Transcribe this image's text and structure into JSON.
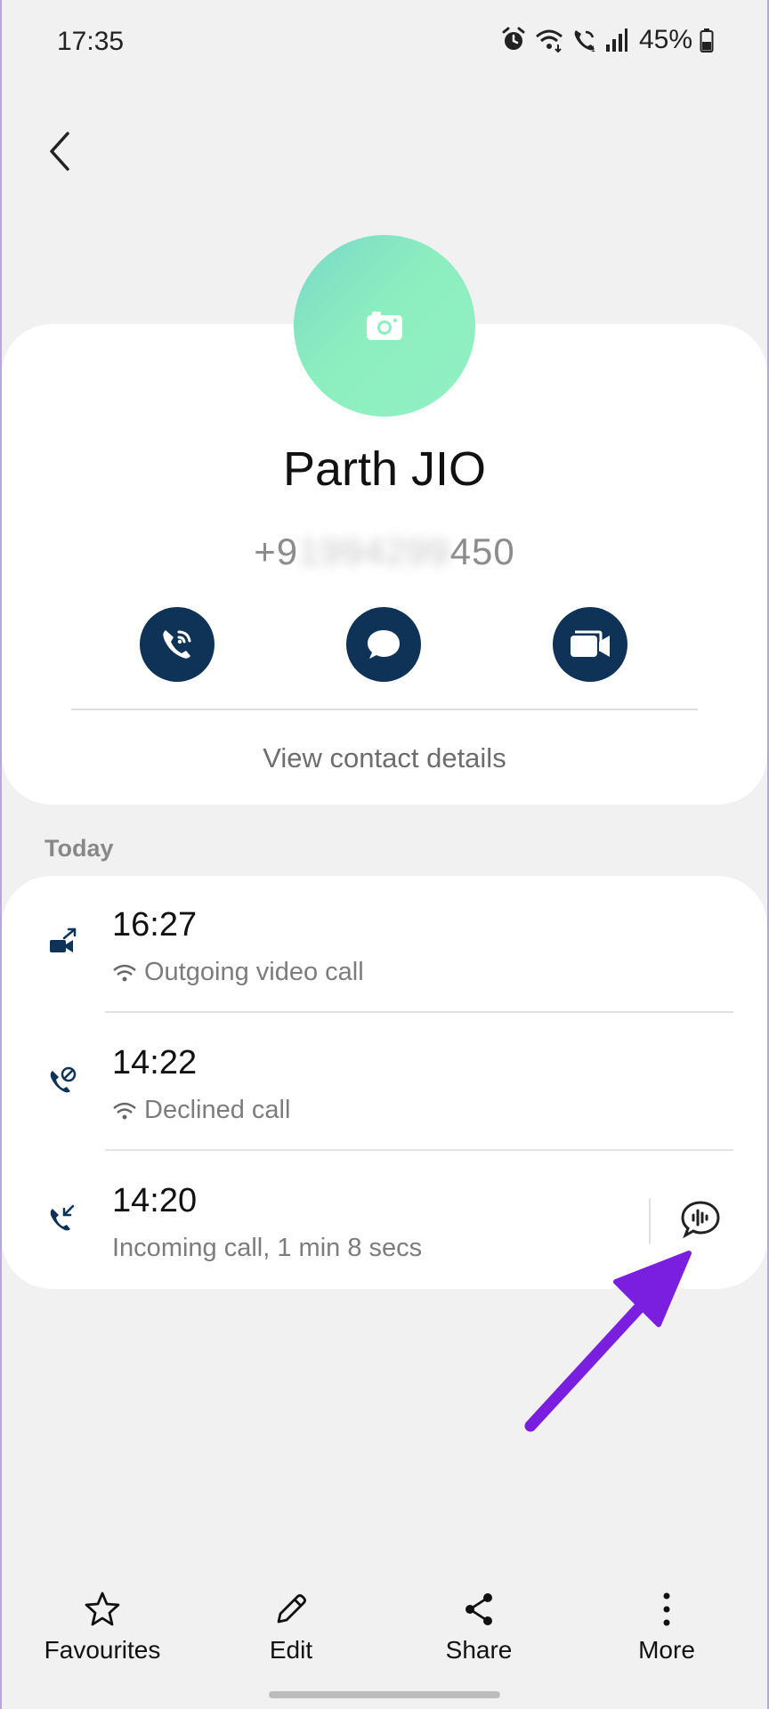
{
  "status_bar": {
    "time": "17:35",
    "battery": "45%"
  },
  "contact": {
    "name": "Parth JIO",
    "phone_prefix": "+9",
    "phone_hidden": "1994299",
    "phone_suffix": "450",
    "view_details": "View contact details"
  },
  "section_label": "Today",
  "calls": [
    {
      "time": "16:27",
      "type": "Outgoing video call",
      "wifi": true
    },
    {
      "time": "14:22",
      "type": "Declined call",
      "wifi": true
    },
    {
      "time": "14:20",
      "type": "Incoming call, 1 min 8 secs",
      "wifi": false
    }
  ],
  "bottom_nav": {
    "favourites": "Favourites",
    "edit": "Edit",
    "share": "Share",
    "more": "More"
  },
  "colors": {
    "accent": "#0f3357",
    "annotation_arrow": "#7a1fe0",
    "avatar": "#8ceebf"
  }
}
